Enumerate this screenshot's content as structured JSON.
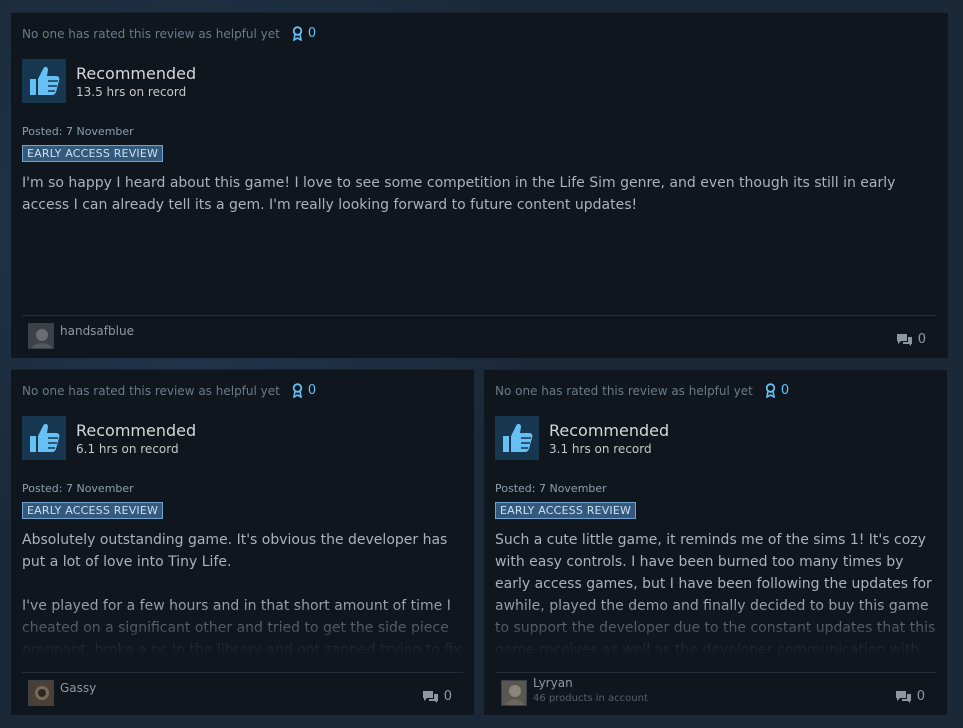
{
  "reviews": [
    {
      "helpful_text": "No one has rated this review as helpful yet",
      "award_count": "0",
      "recommendation": "Recommended",
      "hours": "13.5 hrs on record",
      "posted": "Posted: 7 November",
      "badge": "EARLY ACCESS REVIEW",
      "paragraphs": [
        "I'm so happy I heard about this game! I love to see some competition in the Life Sim genre, and even though its still in early access I can already tell its a gem. I'm really looking forward to future content updates!"
      ],
      "author": "handsafblue",
      "author_sub": "",
      "comment_count": "0"
    },
    {
      "helpful_text": "No one has rated this review as helpful yet",
      "award_count": "0",
      "recommendation": "Recommended",
      "hours": "6.1 hrs on record",
      "posted": "Posted: 7 November",
      "badge": "EARLY ACCESS REVIEW",
      "paragraphs": [
        "Absolutely outstanding game. It's obvious the developer has put a lot of love into Tiny Life.",
        "I've played for a few hours and in that short amount of time I cheated on a significant other and tried to get the side piece pregnant, broke a pc in the library and got zapped trying to fix it"
      ],
      "author": "Gassy",
      "author_sub": "",
      "comment_count": "0"
    },
    {
      "helpful_text": "No one has rated this review as helpful yet",
      "award_count": "0",
      "recommendation": "Recommended",
      "hours": "3.1 hrs on record",
      "posted": "Posted: 7 November",
      "badge": "EARLY ACCESS REVIEW",
      "paragraphs": [
        "Such a cute little game, it reminds me of the sims 1! It's cozy with easy controls. I have been burned too many times by early access games, but I have been following the updates for awhile, played the demo and finally decided to buy this game to support the developer due to the constant updates that this game receives as well as the developer communication with their fan-base and not"
      ],
      "author": "Lyryan",
      "author_sub": "46 products in account",
      "comment_count": "0"
    }
  ],
  "colors": {
    "accent": "#66c0f4",
    "card_bg": "#10161e",
    "page_bg": "#1b2838",
    "badge_bg": "#34597a"
  }
}
